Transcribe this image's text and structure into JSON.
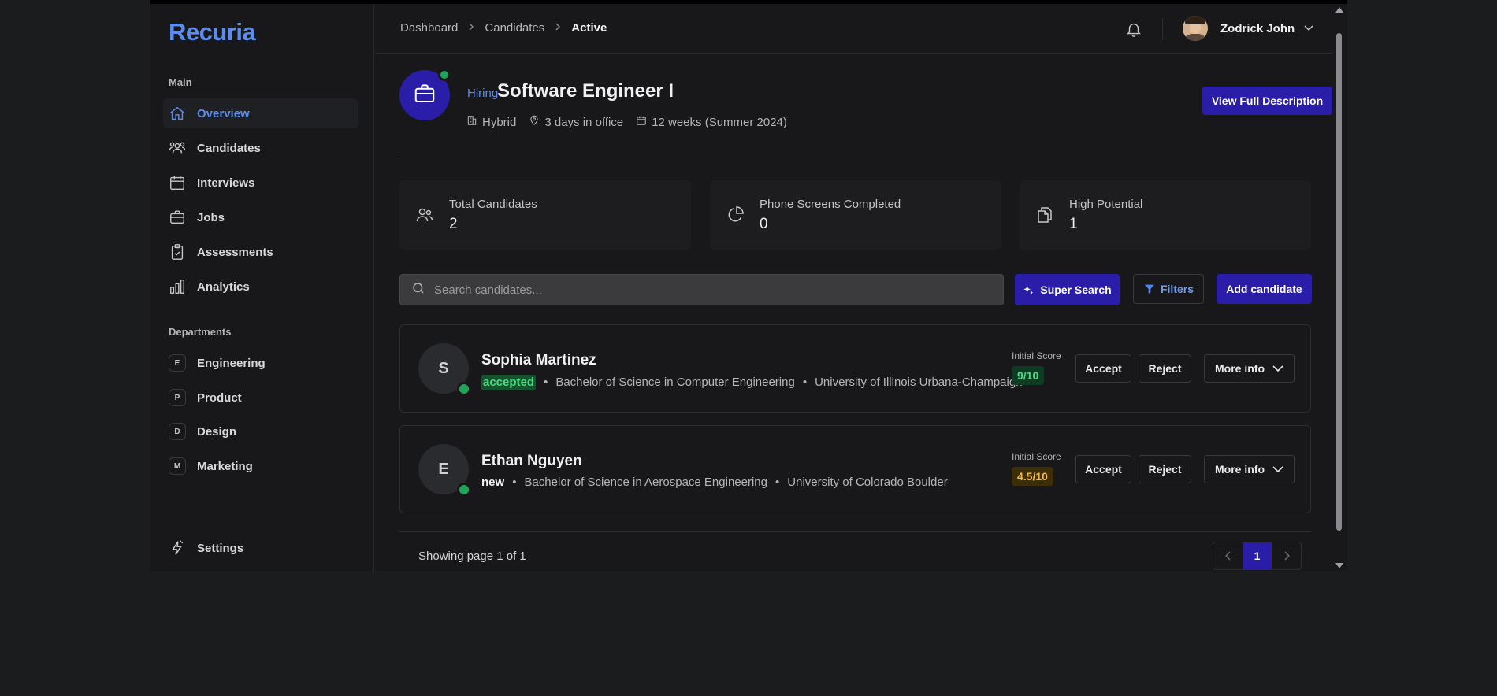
{
  "sidebar": {
    "logo": "Recuria",
    "main_label": "Main",
    "items": [
      {
        "label": "Overview",
        "icon": "home-icon",
        "active": true
      },
      {
        "label": "Candidates",
        "icon": "users-icon"
      },
      {
        "label": "Interviews",
        "icon": "calendar-icon"
      },
      {
        "label": "Jobs",
        "icon": "briefcase-icon"
      },
      {
        "label": "Assessments",
        "icon": "clipboard-check-icon"
      },
      {
        "label": "Analytics",
        "icon": "bar-chart-icon"
      }
    ],
    "departments_label": "Departments",
    "departments": [
      {
        "badge": "E",
        "label": "Engineering"
      },
      {
        "badge": "P",
        "label": "Product"
      },
      {
        "badge": "D",
        "label": "Design"
      },
      {
        "badge": "M",
        "label": "Marketing"
      }
    ],
    "settings_label": "Settings"
  },
  "header": {
    "breadcrumbs": [
      "Dashboard",
      "Candidates",
      "Active"
    ],
    "user_name": "Zodrick John"
  },
  "job": {
    "status_tag": "Hiring",
    "title": "Software Engineer I",
    "work_mode": "Hybrid",
    "office_days": "3 days in office",
    "duration": "12 weeks (Summer 2024)",
    "view_button": "View Full Description"
  },
  "stats": [
    {
      "label": "Total Candidates",
      "value": "2",
      "icon": "users-icon"
    },
    {
      "label": "Phone Screens Completed",
      "value": "0",
      "icon": "pie-chart-icon"
    },
    {
      "label": "High Potential",
      "value": "1",
      "icon": "files-icon"
    }
  ],
  "toolbar": {
    "search_placeholder": "Search candidates...",
    "super_search": "Super Search",
    "filters": "Filters",
    "add_candidate": "Add candidate"
  },
  "candidates": [
    {
      "initial": "S",
      "name": "Sophia Martinez",
      "status": "accepted",
      "degree": "Bachelor of Science in Computer Engineering",
      "university": "University of Illinois Urbana-Champaign",
      "score_label": "Initial Score",
      "score": "9/10",
      "accept": "Accept",
      "reject": "Reject",
      "more": "More info"
    },
    {
      "initial": "E",
      "name": "Ethan Nguyen",
      "status": "new",
      "degree": "Bachelor of Science in Aerospace Engineering",
      "university": "University of Colorado Boulder",
      "score_label": "Initial Score",
      "score": "4.5/10",
      "accept": "Accept",
      "reject": "Reject",
      "more": "More info"
    }
  ],
  "pagination": {
    "showing": "Showing page 1 of 1",
    "current_page": "1"
  },
  "colors": {
    "accent": "#2a1ea8",
    "link": "#5b8def",
    "online": "#1fa55a"
  }
}
